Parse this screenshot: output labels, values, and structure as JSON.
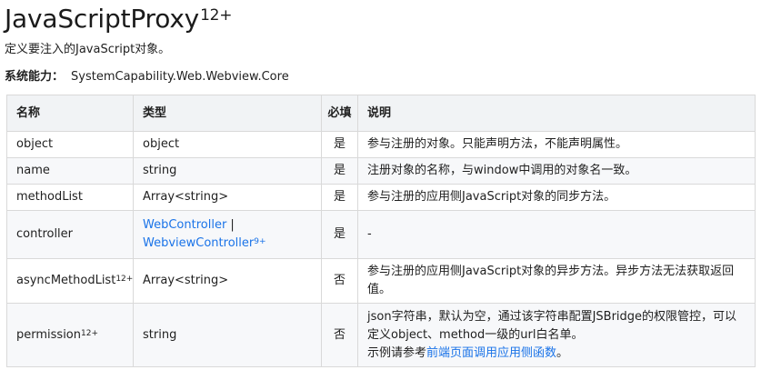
{
  "title": "JavaScriptProxy",
  "title_sup": "12+",
  "description": "定义要注入的JavaScript对象。",
  "capability": {
    "label": "系统能力：",
    "value": "SystemCapability.Web.Webview.Core"
  },
  "table": {
    "headers": {
      "name": "名称",
      "type": "类型",
      "required": "必填",
      "description": "说明"
    },
    "rows": {
      "object": {
        "name": "object",
        "type": "object",
        "required": "是",
        "description": "参与注册的对象。只能声明方法，不能声明属性。"
      },
      "name": {
        "name": "name",
        "type": "string",
        "required": "是",
        "description": "注册对象的名称，与window中调用的对象名一致。"
      },
      "methodList": {
        "name": "methodList",
        "type": "Array<string>",
        "required": "是",
        "description": "参与注册的应用侧JavaScript对象的同步方法。"
      },
      "controller": {
        "name": "controller",
        "type_link1": "WebController",
        "type_sep": " |",
        "type_link2": "WebviewController",
        "type_link2_sup": "9+",
        "required": "是",
        "description": "-"
      },
      "asyncMethodList": {
        "name": "asyncMethodList",
        "name_sup": "12+",
        "type": "Array<string>",
        "required": "否",
        "description": "参与注册的应用侧JavaScript对象的异步方法。异步方法无法获取返回值。"
      },
      "permission": {
        "name": "permission",
        "name_sup": "12+",
        "type": "string",
        "required": "否",
        "description_text": "json字符串，默认为空，通过该字符串配置JSBridge的权限管控，可以定义object、method一级的url白名单。",
        "example_prefix": "示例请参考",
        "example_link": "前端页面调用应用侧函数",
        "example_suffix": "。"
      }
    }
  },
  "colors": {
    "link": "#1a73e8",
    "header_bg": "#f1f3f5",
    "stripe_bg": "#f7f8fa",
    "border": "#d9d9d9"
  }
}
